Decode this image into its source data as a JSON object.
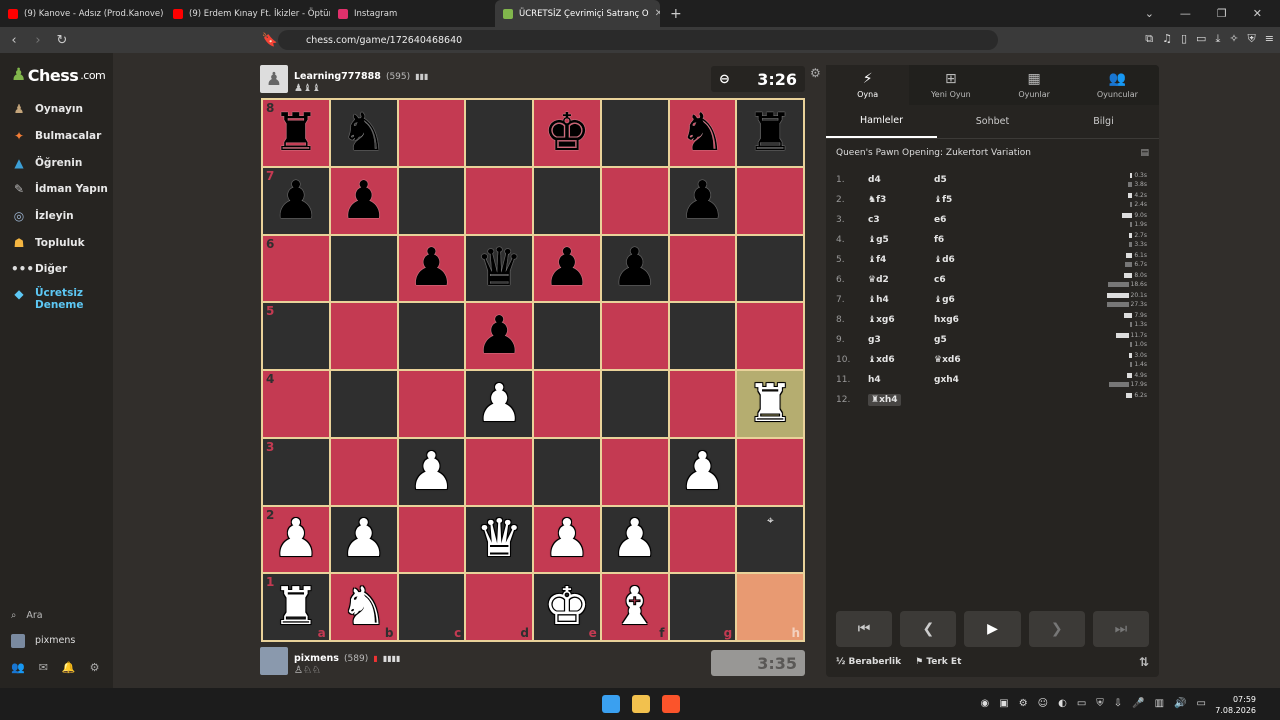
{
  "browser": {
    "tabs": [
      {
        "label": "(9) Kanove - Adsız (Prod.Kanove) - Yo",
        "color": "#ff0000",
        "active": false
      },
      {
        "label": "(9) Erdem Kınay Ft. İkizler - Öptün",
        "color": "#ff0000",
        "active": false
      },
      {
        "label": "Instagram",
        "color": "#e1306c",
        "active": false
      },
      {
        "label": "ÜCRETSİZ Çevrimiçi Satranç O",
        "color": "#81b64c",
        "active": true
      }
    ],
    "new_tab": "+",
    "url": "chess.com/game/172640468640"
  },
  "sidebar": {
    "logo_text": "Chess",
    "logo_suffix": ".com",
    "items": [
      {
        "label": "Oynayın",
        "icon": "board-hand-icon"
      },
      {
        "label": "Bulmacalar",
        "icon": "puzzle-icon"
      },
      {
        "label": "Öğrenin",
        "icon": "graduation-cap-icon"
      },
      {
        "label": "İdman Yapın",
        "icon": "drill-icon"
      },
      {
        "label": "İzleyin",
        "icon": "binoculars-icon"
      },
      {
        "label": "Topluluk",
        "icon": "community-icon"
      },
      {
        "label": "Diğer",
        "icon": "more-icon"
      }
    ],
    "premium_line1": "Ücretsiz",
    "premium_line2": "Deneme",
    "search_label": "Ara",
    "user_label": "pixmens"
  },
  "top_player": {
    "name": "Learning777888",
    "rating": "(595)",
    "captured": "♟♝♝",
    "clock": "3:26"
  },
  "bottom_player": {
    "name": "pixmens",
    "rating": "(589)",
    "captured": "♙♘♘",
    "clock": "3:35"
  },
  "board": {
    "ranks": [
      "8",
      "7",
      "6",
      "5",
      "4",
      "3",
      "2",
      "1"
    ],
    "files": [
      "a",
      "b",
      "c",
      "d",
      "e",
      "f",
      "g",
      "h"
    ],
    "position": [
      [
        "bR",
        "bN",
        "",
        "",
        "bK",
        "",
        "bN",
        "bR"
      ],
      [
        "bP",
        "bP",
        "",
        "",
        "",
        "",
        "bP",
        ""
      ],
      [
        "",
        "",
        "bP",
        "bQ",
        "bP",
        "bP",
        "",
        ""
      ],
      [
        "",
        "",
        "",
        "bP",
        "",
        "",
        "",
        ""
      ],
      [
        "",
        "",
        "",
        "wP",
        "",
        "",
        "",
        "wR"
      ],
      [
        "",
        "",
        "wP",
        "",
        "",
        "",
        "wP",
        ""
      ],
      [
        "wP",
        "wP",
        "",
        "wQ",
        "wP",
        "wP",
        "",
        ""
      ],
      [
        "wR",
        "wN",
        "",
        "",
        "wK",
        "wB",
        "",
        ""
      ]
    ],
    "highlights": [
      [
        4,
        7
      ],
      [
        7,
        7
      ]
    ]
  },
  "panel": {
    "tabs": [
      {
        "label": "Oyna",
        "icon": "bolt-icon"
      },
      {
        "label": "Yeni Oyun",
        "icon": "plus-icon"
      },
      {
        "label": "Oyunlar",
        "icon": "board-icon"
      },
      {
        "label": "Oyuncular",
        "icon": "players-icon"
      }
    ],
    "subtabs": [
      "Hamleler",
      "Sohbet",
      "Bilgi"
    ],
    "opening": "Queen's Pawn Opening: Zukertort Variation",
    "moves": [
      {
        "n": "1.",
        "w": "d4",
        "b": "d5",
        "wt": "0.3s",
        "bt": "3.8s",
        "wf": 0.02,
        "bf": 0.19
      },
      {
        "n": "2.",
        "w": "♞f3",
        "b": "♝f5",
        "wt": "4.2s",
        "bt": "2.4s",
        "wf": 0.21,
        "bf": 0.12
      },
      {
        "n": "3.",
        "w": "c3",
        "b": "e6",
        "wt": "9.0s",
        "bt": "1.9s",
        "wf": 0.45,
        "bf": 0.1
      },
      {
        "n": "4.",
        "w": "♝g5",
        "b": "f6",
        "wt": "2.7s",
        "bt": "3.3s",
        "wf": 0.14,
        "bf": 0.17
      },
      {
        "n": "5.",
        "w": "♝f4",
        "b": "♝d6",
        "wt": "6.1s",
        "bt": "6.7s",
        "wf": 0.31,
        "bf": 0.34
      },
      {
        "n": "6.",
        "w": "♛d2",
        "b": "c6",
        "wt": "8.0s",
        "bt": "18.6s",
        "wf": 0.4,
        "bf": 0.93
      },
      {
        "n": "7.",
        "w": "♝h4",
        "b": "♝g6",
        "wt": "20.1s",
        "bt": "27.3s",
        "wf": 1.0,
        "bf": 1.0
      },
      {
        "n": "8.",
        "w": "♝xg6",
        "b": "hxg6",
        "wt": "7.9s",
        "bt": "1.3s",
        "wf": 0.4,
        "bf": 0.07
      },
      {
        "n": "9.",
        "w": "g3",
        "b": "g5",
        "wt": "11.7s",
        "bt": "1.0s",
        "wf": 0.58,
        "bf": 0.05
      },
      {
        "n": "10.",
        "w": "♝xd6",
        "b": "♛xd6",
        "wt": "3.0s",
        "bt": "1.4s",
        "wf": 0.15,
        "bf": 0.07
      },
      {
        "n": "11.",
        "w": "h4",
        "b": "gxh4",
        "wt": "4.9s",
        "bt": "17.9s",
        "wf": 0.25,
        "bf": 0.89
      },
      {
        "n": "12.",
        "w": "♜xh4",
        "b": "",
        "wt": "6.2s",
        "bt": "",
        "wf": 0.31,
        "bf": 0
      }
    ],
    "draw_label": "Beraberlik",
    "draw_prefix": "½",
    "resign_label": "Terk Et"
  },
  "taskbar": {
    "time": "07:59",
    "date": "7.08.2026"
  }
}
